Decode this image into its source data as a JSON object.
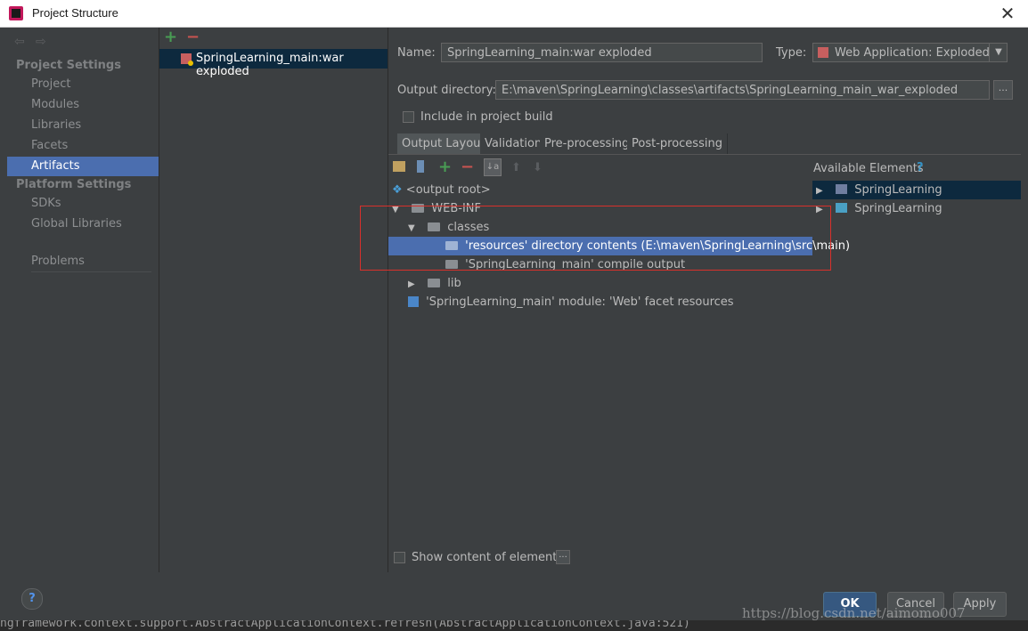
{
  "window": {
    "title": "Project Structure",
    "close_label": "✕"
  },
  "nav": {
    "project_settings_header": "Project Settings",
    "platform_settings_header": "Platform Settings",
    "items": [
      {
        "label": "Project"
      },
      {
        "label": "Modules"
      },
      {
        "label": "Libraries"
      },
      {
        "label": "Facets"
      },
      {
        "label": "Artifacts",
        "selected": true
      },
      {
        "label": "SDKs"
      },
      {
        "label": "Global Libraries"
      },
      {
        "label": "Problems"
      }
    ]
  },
  "artifact_list": {
    "items": [
      {
        "label": "SpringLearning_main:war exploded"
      }
    ]
  },
  "form": {
    "name_label": "Name:",
    "name_value": "SpringLearning_main:war exploded",
    "type_label": "Type:",
    "type_value": "Web Application: Exploded",
    "output_dir_label": "Output directory:",
    "output_dir_value": "E:\\maven\\SpringLearning\\classes\\artifacts\\SpringLearning_main_war_exploded",
    "output_dir_button": "...",
    "include_build_label": "Include in project build"
  },
  "tabs": [
    {
      "label": "Output Layout",
      "active": true
    },
    {
      "label": "Validation"
    },
    {
      "label": "Pre-processing"
    },
    {
      "label": "Post-processing"
    }
  ],
  "layout_tree": {
    "output_root": "<output root>",
    "web_inf": "WEB-INF",
    "classes": "classes",
    "resources": "'resources' directory contents (E:\\maven\\SpringLearning\\src\\main)",
    "compile_output": "'SpringLearning_main' compile output",
    "lib": "lib",
    "facet_resources": "'SpringLearning_main' module: 'Web' facet resources"
  },
  "available": {
    "header": "Available Elements",
    "help": "?",
    "items": [
      {
        "label": "SpringLearning"
      },
      {
        "label": "SpringLearning"
      }
    ]
  },
  "show_content_label": "Show content of elements",
  "show_content_button": "...",
  "footer": {
    "help": "?",
    "ok": "OK",
    "cancel": "Cancel",
    "apply": "Apply"
  },
  "watermark": "https://blog.csdn.net/aimomo007",
  "background_code": "ngframework.context.support.AbstractApplicationContext.refresh(AbstractApplicationContext.java:521)"
}
